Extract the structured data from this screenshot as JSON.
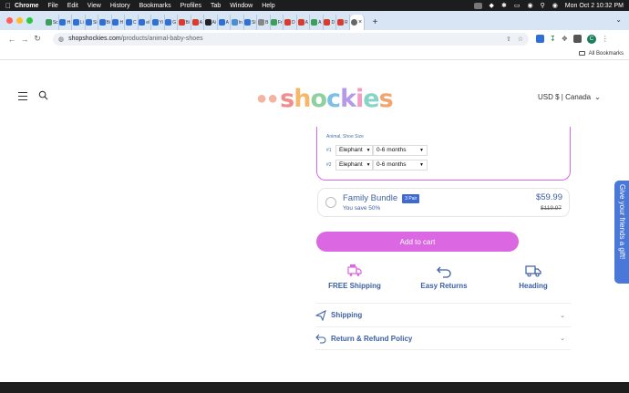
{
  "menubar": {
    "app": "Chrome",
    "items": [
      "File",
      "Edit",
      "View",
      "History",
      "Bookmarks",
      "Profiles",
      "Tab",
      "Window",
      "Help"
    ],
    "datetime": "Mon Oct 2  10:32 PM"
  },
  "tabs": [
    {
      "label": "Sc",
      "color": "#3b9e5a"
    },
    {
      "label": "H",
      "color": "#2f6fd6"
    },
    {
      "label": "Li",
      "color": "#2f6fd6"
    },
    {
      "label": "Si",
      "color": "#2f6fd6"
    },
    {
      "label": "Bi",
      "color": "#2f6fd6"
    },
    {
      "label": "H",
      "color": "#2f6fd6"
    },
    {
      "label": "C",
      "color": "#2f6fd6"
    },
    {
      "label": "el",
      "color": "#2f6fd6"
    },
    {
      "label": "Yi",
      "color": "#2f6fd6"
    },
    {
      "label": "G",
      "color": "#2f6fd6"
    },
    {
      "label": "Bi",
      "color": "#d93b2c"
    },
    {
      "label": "A",
      "color": "#d93b2c"
    },
    {
      "label": "Ai",
      "color": "#222222"
    },
    {
      "label": "A",
      "color": "#2f6fd6"
    },
    {
      "label": "In",
      "color": "#4a8fd1"
    },
    {
      "label": "Si",
      "color": "#2f6fd6"
    },
    {
      "label": "B",
      "color": "#888888"
    },
    {
      "label": "Fr",
      "color": "#3b9e5a"
    },
    {
      "label": "D",
      "color": "#d93b2c"
    },
    {
      "label": "A",
      "color": "#d93b2c"
    },
    {
      "label": "A",
      "color": "#3b9e5a"
    },
    {
      "label": "D",
      "color": "#d93b2c"
    },
    {
      "label": "R",
      "color": "#d93b2c"
    }
  ],
  "toolbar": {
    "url_domain": "shopshockies.com",
    "url_path": "/products/animal-baby-shoes",
    "profile_initial": "C"
  },
  "bookmarks": {
    "all_label": "All Bookmarks"
  },
  "page": {
    "logo_text": "shockies",
    "currency": "USD $ | Canada",
    "bundle": {
      "header": "Animal, Shoe Size",
      "rows": [
        {
          "num": "#1",
          "animal": "Elephant",
          "size": "0-6 months"
        },
        {
          "num": "#2",
          "animal": "Elephant",
          "size": "0-6 months"
        }
      ]
    },
    "family": {
      "title": "Family Bundle",
      "badge": "3 Pair",
      "save": "You save 50%",
      "price": "$59.99",
      "old_price": "$119.97"
    },
    "add_to_cart": "Add to cart",
    "features": [
      {
        "label": "FREE Shipping",
        "icon": "truck-badge-icon"
      },
      {
        "label": "Easy Returns",
        "icon": "return-arrow-icon"
      },
      {
        "label": "Heading",
        "icon": "truck-icon"
      }
    ],
    "accordion": [
      {
        "label": "Shipping",
        "icon": "plane-icon"
      },
      {
        "label": "Return & Refund Policy",
        "icon": "return-icon"
      }
    ],
    "gift_tab": "Give your friends a gift!"
  },
  "colors": {
    "accent_pink": "#dc67e2",
    "text_blue": "#3c5fa3",
    "gift_blue": "#4a78d9"
  }
}
